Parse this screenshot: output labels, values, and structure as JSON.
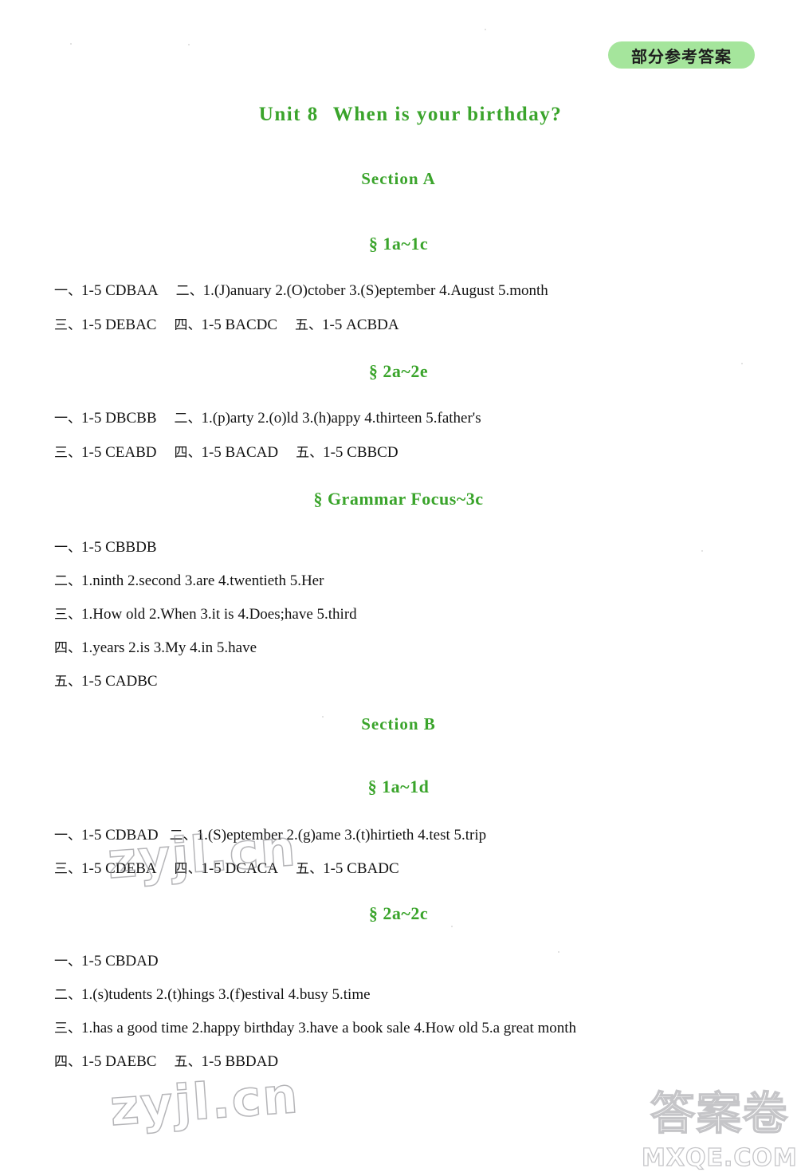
{
  "header": {
    "badge_label": "部分参考答案"
  },
  "unit": {
    "number_label": "Unit 8",
    "title": "When is your birthday?"
  },
  "sections": [
    {
      "name": "Section A",
      "subsections": [
        {
          "heading": "§ 1a~1c",
          "lines": [
            {
              "parts": [
                {
                  "cn": "一、",
                  "text": "1-5 CDBAA"
                },
                {
                  "cn": "二、",
                  "text": "1.(J)anuary   2.(O)ctober   3.(S)eptember   4.August   5.month"
                }
              ]
            },
            {
              "parts": [
                {
                  "cn": "三、",
                  "text": "1-5 DEBAC"
                },
                {
                  "cn": "四、",
                  "text": "1-5 BACDC"
                },
                {
                  "cn": "五、",
                  "text": "1-5 ACBDA"
                }
              ]
            }
          ]
        },
        {
          "heading": "§ 2a~2e",
          "lines": [
            {
              "parts": [
                {
                  "cn": "一、",
                  "text": "1-5 DBCBB"
                },
                {
                  "cn": "二、",
                  "text": "1.(p)arty   2.(o)ld   3.(h)appy   4.thirteen   5.father's"
                }
              ]
            },
            {
              "parts": [
                {
                  "cn": "三、",
                  "text": "1-5 CEABD"
                },
                {
                  "cn": "四、",
                  "text": "1-5 BACAD"
                },
                {
                  "cn": "五、",
                  "text": "1-5 CBBCD"
                }
              ]
            }
          ]
        },
        {
          "heading": "§ Grammar Focus~3c",
          "lines": [
            {
              "parts": [
                {
                  "cn": "一、",
                  "text": "1-5 CBBDB"
                }
              ]
            },
            {
              "parts": [
                {
                  "cn": "二、",
                  "text": "1.ninth   2.second   3.are   4.twentieth   5.Her"
                }
              ]
            },
            {
              "parts": [
                {
                  "cn": "三、",
                  "text": "1.How old   2.When   3.it is   4.Does;have   5.third"
                }
              ]
            },
            {
              "parts": [
                {
                  "cn": "四、",
                  "text": "1.years   2.is   3.My   4.in   5.have"
                }
              ]
            },
            {
              "parts": [
                {
                  "cn": "五、",
                  "text": "1-5 CADBC"
                }
              ]
            }
          ]
        }
      ]
    },
    {
      "name": "Section B",
      "subsections": [
        {
          "heading": "§ 1a~1d",
          "lines": [
            {
              "parts": [
                {
                  "cn": "一、",
                  "text": "1-5 CDBAD"
                },
                {
                  "cn": "二、",
                  "text": "1.(S)eptember   2.(g)ame   3.(t)hirtieth   4.test   5.trip"
                }
              ]
            },
            {
              "parts": [
                {
                  "cn": "三、",
                  "text": "1-5 CDEBA"
                },
                {
                  "cn": "四、",
                  "text": "1-5 DCACA"
                },
                {
                  "cn": "五、",
                  "text": "1-5 CBADC"
                }
              ]
            }
          ]
        },
        {
          "heading": "§ 2a~2c",
          "lines": [
            {
              "parts": [
                {
                  "cn": "一、",
                  "text": "1-5 CBDAD"
                }
              ]
            },
            {
              "parts": [
                {
                  "cn": "二、",
                  "text": "1.(s)tudents   2.(t)hings   3.(f)estival   4.busy   5.time"
                }
              ]
            },
            {
              "parts": [
                {
                  "cn": "三、",
                  "text": "1.has a good time   2.happy birthday   3.have a book sale   4.How old   5.a great month"
                }
              ]
            },
            {
              "parts": [
                {
                  "cn": "四、",
                  "text": "1-5 DAEBC"
                },
                {
                  "cn": "五、",
                  "text": "1-5 BBDAD"
                }
              ]
            }
          ]
        }
      ]
    }
  ],
  "watermarks": {
    "site_mid": "zyjl.cn",
    "site_bottom": "zyjl.cn",
    "brand_cn": "答案卷",
    "brand_domain": "MXQE.COM"
  },
  "colors": {
    "heading_green": "#3aa42b",
    "badge_bg": "#a5e59c",
    "text": "#121212",
    "page_bg": "#ffffff"
  }
}
